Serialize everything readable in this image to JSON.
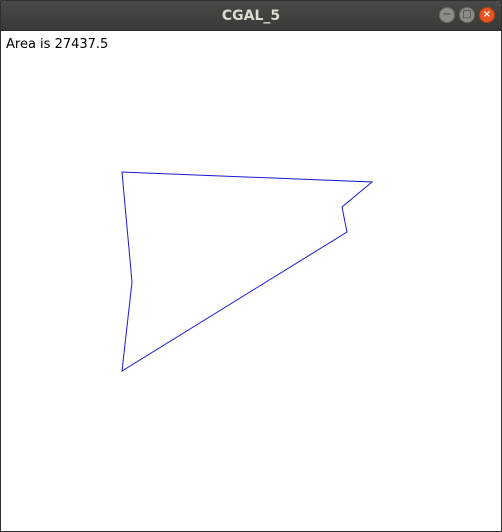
{
  "window": {
    "title": "CGAL_5",
    "controls": {
      "minimize_icon": "−",
      "maximize_icon": "□",
      "close_icon": "×"
    }
  },
  "content": {
    "area_text": "Area is 27437.5"
  },
  "colors": {
    "polygon_stroke": "#1a1ad4",
    "background": "#ffffff",
    "close_button": "#e95420"
  }
}
